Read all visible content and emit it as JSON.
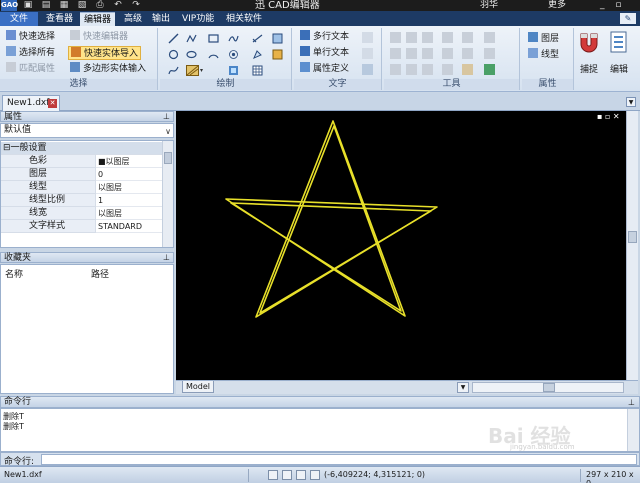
{
  "window": {
    "app_logo": "GAO",
    "title": "迅捷CAD编辑器",
    "title_visible": "迅   CAD编辑器",
    "right_user": "羽华",
    "right_more": "更多",
    "qa_icons": [
      "new-icon",
      "open-icon",
      "save-icon",
      "saveas-icon",
      "print-icon",
      "undo-icon",
      "redo-icon"
    ]
  },
  "tabs": [
    {
      "label": "文件"
    },
    {
      "label": "查看器"
    },
    {
      "label": "编辑器"
    },
    {
      "label": "高级"
    },
    {
      "label": "输出"
    },
    {
      "label": "VIP功能"
    },
    {
      "label": "相关软件"
    }
  ],
  "ribbon": {
    "select": {
      "label": "选择",
      "quick_select": "快速选择",
      "select_all": "选择所有",
      "match_props": "匹配属性",
      "quick_editor": "快速编辑器",
      "quick_entity_import": "快速实体导入",
      "polygon_entity_input": "多边形实体输入"
    },
    "draw": {
      "label": "绘制"
    },
    "text": {
      "label": "文字",
      "mtext": "多行文本",
      "stext": "单行文本",
      "attdef": "属性定义"
    },
    "tools": {
      "label": "工具"
    },
    "props": {
      "label": "属性",
      "layers": "图层",
      "linetype": "线型"
    },
    "snap": "捕捉",
    "edit": "编辑"
  },
  "document": {
    "tab": "New1.dxf"
  },
  "properties": {
    "header": "属性",
    "selection": "默认值",
    "section": "一般设置",
    "rows": [
      {
        "key": "色彩",
        "value": "■以图层"
      },
      {
        "key": "图层",
        "value": "0"
      },
      {
        "key": "线型",
        "value": "以图层"
      },
      {
        "key": "线型比例",
        "value": "1"
      },
      {
        "key": "线宽",
        "value": "以图层"
      },
      {
        "key": "文字样式",
        "value": "STANDARD"
      }
    ]
  },
  "favorites": {
    "header": "收藏夹",
    "col_name": "名称",
    "col_path": "路径"
  },
  "canvas": {
    "layout_tab": "Model",
    "background": "#000000",
    "stroke_color": "#e8e02a"
  },
  "command": {
    "header": "命令行",
    "lines": [
      "删除T",
      "删除T"
    ],
    "prompt": "命令行:"
  },
  "status": {
    "file": "New1.dxf",
    "coords": "(-6,409224; 4,315121; 0)",
    "size": "297 x 210 x 0"
  },
  "watermark": {
    "text": "Bai 经验",
    "sub": "jingyan.baidu.com"
  },
  "colors": {
    "accent": "#3a6fc4",
    "ribbon_bg": "#dfe8f3",
    "titlebar": "#1c1c1c"
  }
}
